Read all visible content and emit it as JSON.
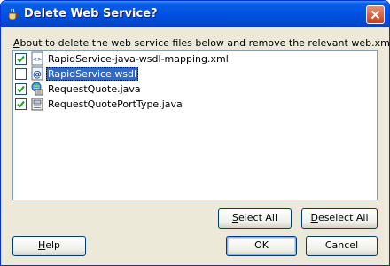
{
  "window": {
    "title": "Delete Web Service?"
  },
  "instruction": {
    "hotkey": "A",
    "rest": "bout to delete the web service files below and remove the relevant web.xml entries."
  },
  "files": [
    {
      "name": "RapidService-java-wsdl-mapping.xml",
      "checked": true,
      "selected": false,
      "icon": "xml-file-icon"
    },
    {
      "name": "RapidService.wsdl",
      "checked": false,
      "selected": true,
      "icon": "wsdl-file-icon"
    },
    {
      "name": "RequestQuote.java",
      "checked": true,
      "selected": false,
      "icon": "java-class-icon"
    },
    {
      "name": "RequestQuotePortType.java",
      "checked": true,
      "selected": false,
      "icon": "java-interface-icon"
    }
  ],
  "buttons": {
    "select_all": {
      "hotkey": "S",
      "rest": "elect All"
    },
    "deselect_all": {
      "hotkey": "D",
      "rest": "eselect All"
    },
    "help": {
      "hotkey": "H",
      "rest": "elp"
    },
    "ok": "OK",
    "cancel": "Cancel"
  },
  "colors": {
    "title_bar": "#0055e5",
    "selection": "#316ac5",
    "dialog_bg": "#ece9d8"
  }
}
